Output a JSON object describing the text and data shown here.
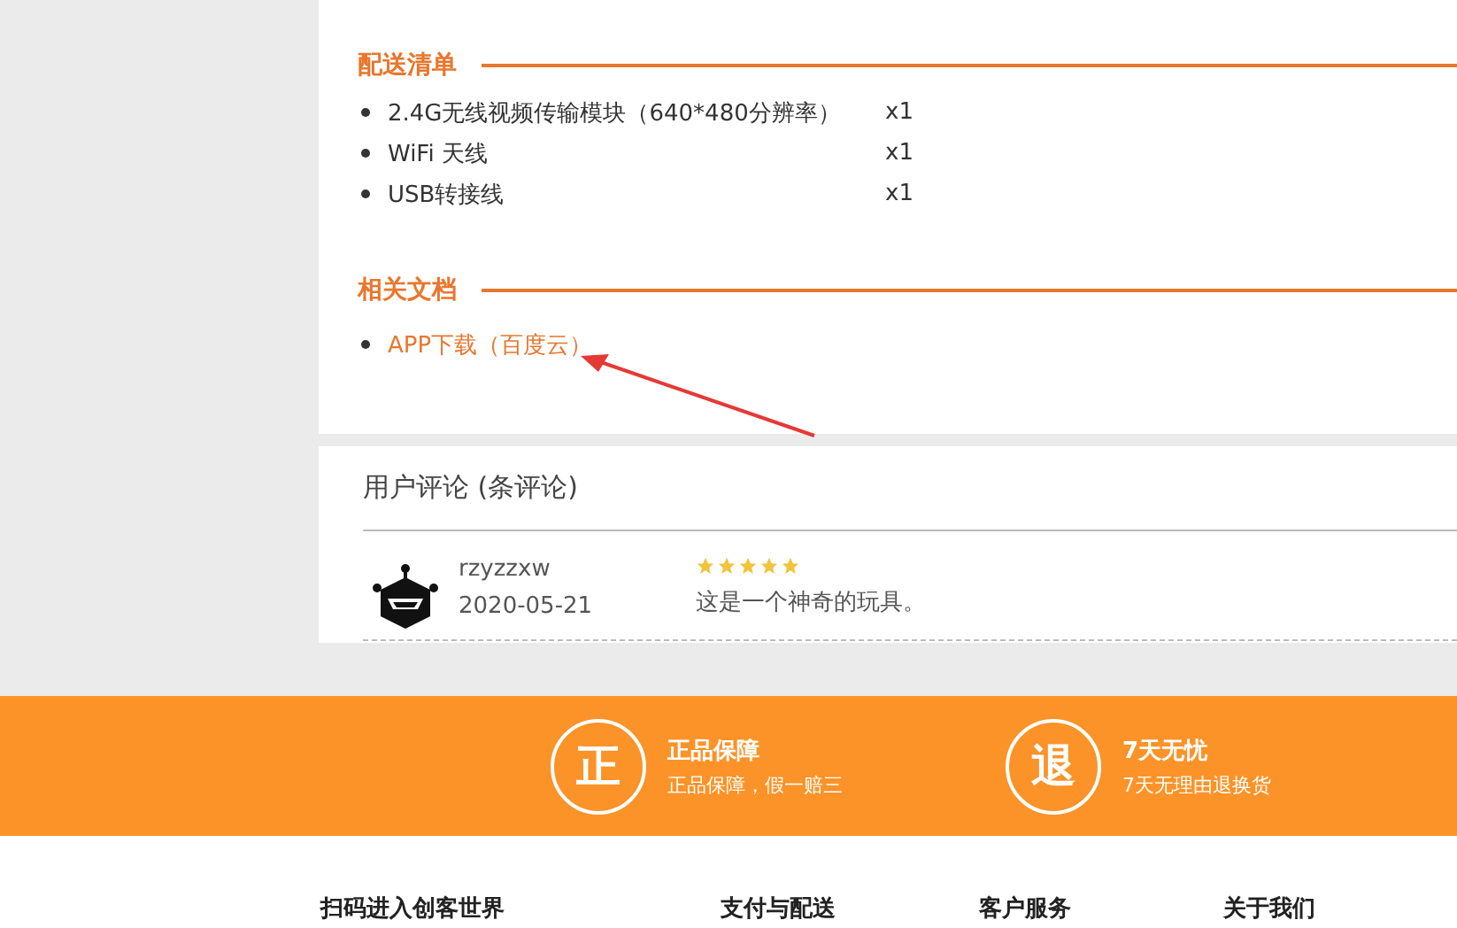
{
  "delivery_list": {
    "heading": "配送清单",
    "items": [
      {
        "name": "2.4G无线视频传输模块（640*480分辨率）",
        "quantity": "x1"
      },
      {
        "name": "WiFi 天线",
        "quantity": "x1"
      },
      {
        "name": "USB转接线",
        "quantity": "x1"
      }
    ]
  },
  "documents": {
    "heading": "相关文档",
    "links": [
      "APP下载（百度云）"
    ]
  },
  "reviews": {
    "title": "用户评论 (条评论)",
    "items": [
      {
        "user": "rzyzzxw",
        "date": "2020-05-21",
        "stars": 5,
        "comment": "这是一个神奇的玩具。"
      }
    ]
  },
  "guarantees": [
    {
      "badge": "正",
      "title": "正品保障",
      "subtitle": "正品保障，假一赔三"
    },
    {
      "badge": "退",
      "title": "7天无忧",
      "subtitle": "7天无理由退换货"
    }
  ],
  "footer": {
    "columns": [
      "扫码进入创客世界",
      "支付与配送",
      "客户服务",
      "关于我们"
    ]
  }
}
